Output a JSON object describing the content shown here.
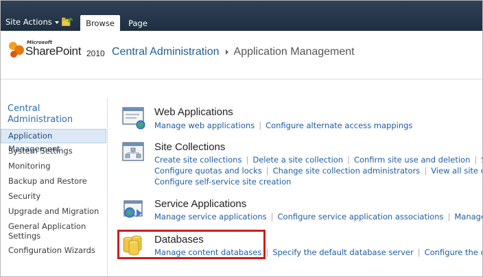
{
  "ribbon": {
    "site_actions": "Site Actions",
    "tabs": [
      "Browse",
      "Page"
    ]
  },
  "header": {
    "logo_microsoft": "Microsoft",
    "logo_product": "SharePoint",
    "logo_year": "2010",
    "breadcrumb_root": "Central Administration",
    "breadcrumb_current": "Application Management"
  },
  "sidebar": {
    "heading": "Central Administration",
    "items": [
      {
        "label": "Application Management",
        "selected": true
      },
      {
        "label": "System Settings"
      },
      {
        "label": "Monitoring"
      },
      {
        "label": "Backup and Restore"
      },
      {
        "label": "Security"
      },
      {
        "label": "Upgrade and Migration"
      },
      {
        "label": "General Application Settings"
      },
      {
        "label": "Configuration Wizards"
      }
    ]
  },
  "sections": [
    {
      "title": "Web Applications",
      "icon": "web-applications-icon",
      "links": [
        [
          "Manage web applications",
          "Configure alternate access mappings"
        ]
      ]
    },
    {
      "title": "Site Collections",
      "icon": "site-collections-icon",
      "links": [
        [
          "Create site collections",
          "Delete a site collection",
          "Confirm site use and deletion",
          "S"
        ],
        [
          "Configure quotas and locks",
          "Change site collection administrators",
          "View all site c"
        ],
        [
          "Configure self-service site creation"
        ]
      ]
    },
    {
      "title": "Service Applications",
      "icon": "service-applications-icon",
      "links": [
        [
          "Manage service applications",
          "Configure service application associations",
          "Manage"
        ]
      ]
    },
    {
      "title": "Databases",
      "icon": "databases-icon",
      "links": [
        [
          "Manage content databases",
          "Specify the default database server",
          "Configure the d"
        ]
      ]
    }
  ],
  "colors": {
    "ribbon_bg": "#2a3a4e",
    "link": "#1d5da0",
    "highlight_box": "#c81d1d"
  }
}
